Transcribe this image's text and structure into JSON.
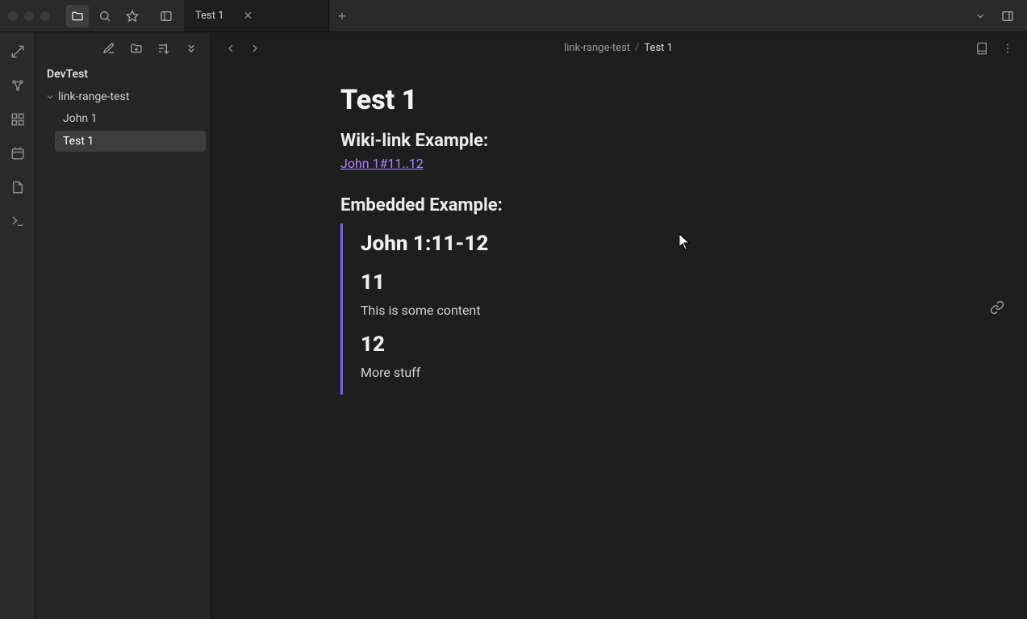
{
  "titlebar": {
    "icons": {
      "files": "folder-icon",
      "search": "search-icon",
      "star": "star-icon",
      "layout": "sidebar-toggle-icon"
    }
  },
  "tabs": {
    "items": [
      {
        "title": "Test 1"
      }
    ],
    "new_tab_label": "+"
  },
  "sidebar": {
    "vault_name": "DevTest",
    "toolbar": {
      "new_note": "new-note",
      "new_folder": "new-folder",
      "sort": "sort",
      "collapse": "collapse"
    },
    "tree": {
      "folder_name": "link-range-test",
      "files": [
        {
          "name": "John 1",
          "active": false
        },
        {
          "name": "Test 1",
          "active": true
        }
      ]
    }
  },
  "content_header": {
    "breadcrumb": [
      "link-range-test",
      "Test 1"
    ]
  },
  "document": {
    "title": "Test 1",
    "section_wiki": {
      "heading": "Wiki-link Example:",
      "link_text": "John 1#11..12"
    },
    "section_embed": {
      "heading": "Embedded Example:",
      "embed_title": "John 1:11-12",
      "blocks": [
        {
          "h": "11",
          "p": "This is some content"
        },
        {
          "h": "12",
          "p": "More stuff"
        }
      ]
    }
  }
}
